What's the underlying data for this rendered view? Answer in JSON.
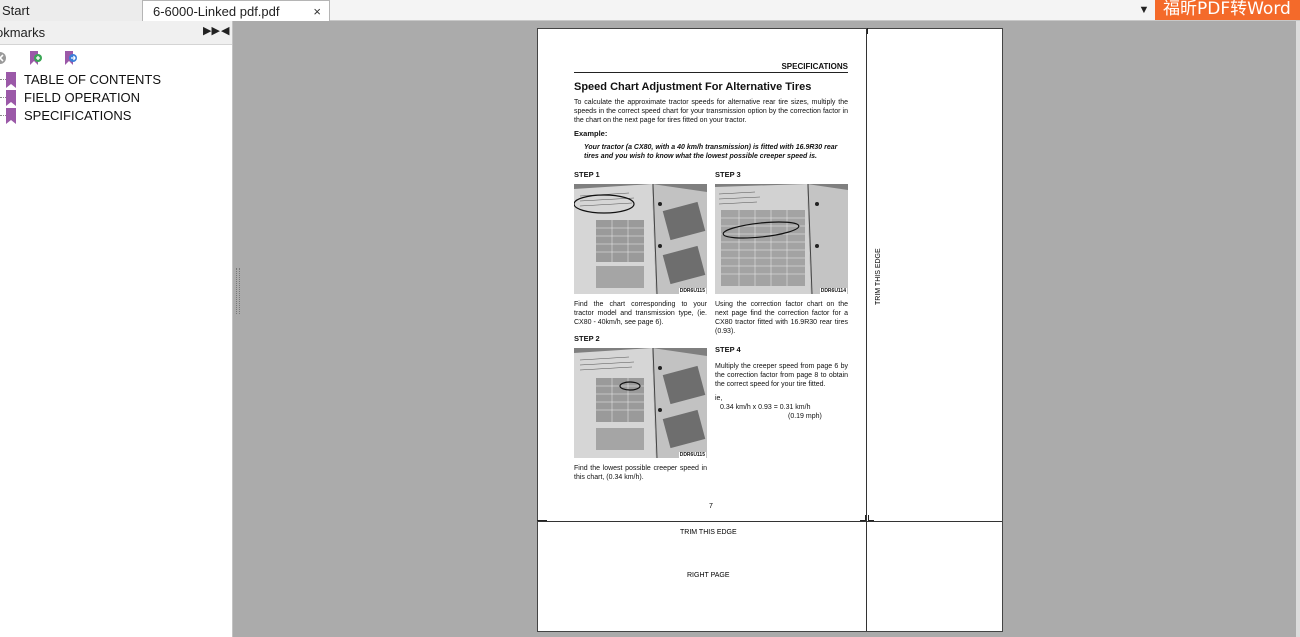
{
  "tabs": {
    "start_label": "Start",
    "doc_label": "6-6000-Linked pdf.pdf",
    "close_glyph": "×",
    "menu_glyph": "▼"
  },
  "promo": {
    "text": "福昕PDF转Word"
  },
  "sidebar": {
    "title": "okmarks",
    "collapse_glyph": "▶▶",
    "close_glyph": "◀",
    "items": [
      {
        "label": "TABLE OF CONTENTS"
      },
      {
        "label": "FIELD OPERATION"
      },
      {
        "label": "SPECIFICATIONS"
      }
    ]
  },
  "document": {
    "section": "SPECIFICATIONS",
    "title": "Speed Chart Adjustment For Alternative Tires",
    "intro": "To calculate the approximate tractor speeds for alternative rear tire sizes, multiply the speeds in the correct speed chart for your transmission option by the correction factor in the chart on the next page for tires fitted on your tractor.",
    "example_label": "Example:",
    "example_text": "Your tractor (a CX80, with a 40 km/h transmission) is fitted with 16.9R30 rear tires and you wish to know what the lowest possible creeper speed is.",
    "steps": [
      {
        "label": "STEP  1",
        "code": "DDR6U115",
        "text": "Find the chart corresponding to your tractor model and transmission type, (ie. CX80 - 40km/h, see page 6)."
      },
      {
        "label": "STEP  2",
        "code": "DDR6U115",
        "text": "Find the lowest possible creeper speed in this chart, (0.34 km/h)."
      },
      {
        "label": "STEP  3",
        "code": "DDR6U114",
        "text": "Using the correction factor chart on the next page find the correction factor for a CX80 tractor fitted with 16.9R30 rear tires (0.93)."
      },
      {
        "label": "STEP  4",
        "text": "Multiply the creeper speed from page 6 by the correction factor from page 8 to obtain the correct speed for your tire fitted."
      }
    ],
    "calc_ie": "ie,",
    "calc_line1": "0.34 km/h x 0.93 = 0.31 km/h",
    "calc_line2": "(0.19 mph)",
    "page_number": "7",
    "trim_bottom": "TRIM THIS EDGE",
    "right_page": "RIGHT PAGE",
    "trim_side": "TRIM THIS EDGE"
  },
  "colors": {
    "promo_bg": "#f46a2a",
    "bookmark_icon": "#9b59a8",
    "canvas_bg": "#ababab"
  },
  "icons": {
    "tool_1": "delete-bookmark-icon",
    "tool_2": "add-bookmark-icon",
    "tool_3": "goto-bookmark-icon",
    "bookmark": "bookmark-ribbon-icon"
  }
}
